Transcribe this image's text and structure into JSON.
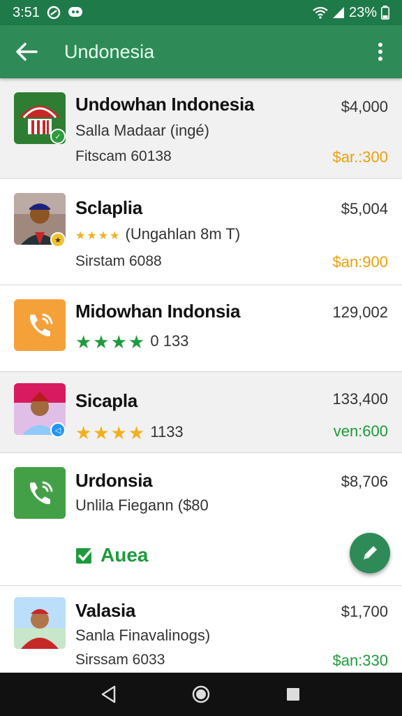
{
  "status_bar": {
    "time": "3:51",
    "battery": "23%",
    "icons": [
      "sync-icon",
      "chat-bubble-icon",
      "wifi-icon",
      "signal-icon",
      "battery-icon"
    ]
  },
  "app_bar": {
    "title": "Undonesia",
    "back_icon": "arrow-left-icon",
    "menu_icon": "more-vert-icon",
    "color": "#2e8b57"
  },
  "items": [
    {
      "name": "Undowhan Indonesia",
      "subtitle": "Salla Madaar (ingé)",
      "meta": "Fitscam 60138",
      "price": "$4,000",
      "tag": "$ar.:300",
      "tag_color": "#e8a10c",
      "thumb": "umbrella-logo"
    },
    {
      "name": "Sclaplia",
      "stars": "★★★★",
      "subtitle": "(Ungahlan 8m T)",
      "meta": "Sirstam 6088",
      "price": "$5,004",
      "tag": "$an:900",
      "tag_color": "#e8a10c",
      "thumb": "man-portrait-photo"
    },
    {
      "name": "Midowhan Indonsia",
      "stars": "★★★★",
      "subtitle": "0 133",
      "price": "129,002",
      "thumb": "phone-icon-orange"
    },
    {
      "name": "Sicapla",
      "stars": "★★★★",
      "subtitle": "1133",
      "price": "133,400",
      "tag": "ven:600",
      "tag_color": "#1e9a3c",
      "thumb": "man-red-hat-photo"
    },
    {
      "name": "Urdonsia",
      "subtitle": "Unlila Fiegann ($80",
      "price": "$8,706",
      "action": "Auea",
      "action_icon": "checkbox-icon",
      "thumb": "phone-icon-green"
    },
    {
      "name": "Valasia",
      "subtitle": "Sanla Finavalinogs)",
      "meta": "Sirssam 6033",
      "price": "$1,700",
      "tag": "$an:330",
      "tag_color": "#1e9a3c",
      "thumb": "woman-red-hat-photo"
    }
  ],
  "fab": {
    "icon": "pencil-icon"
  },
  "nav_bar": {
    "icons": [
      "back-triangle-icon",
      "home-circle-icon",
      "recents-square-icon"
    ]
  }
}
